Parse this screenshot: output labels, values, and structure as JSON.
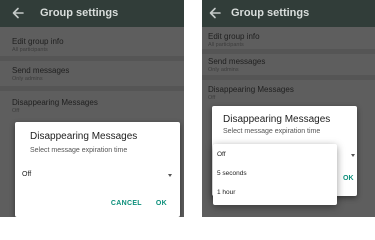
{
  "screens": [
    {
      "appbar": {
        "title": "Group settings",
        "back_icon": "arrow-left-icon"
      },
      "settings": [
        {
          "title": "Edit group info",
          "subtitle": "All participants"
        },
        {
          "title": "Send messages",
          "subtitle": "Only admins"
        },
        {
          "title": "Disappearing Messages",
          "subtitle": "Off"
        }
      ],
      "dialog": {
        "title": "Disappearing Messages",
        "subtitle": "Select message expiration time",
        "selected_value": "Off",
        "cancel_label": "CANCEL",
        "ok_label": "OK"
      }
    },
    {
      "appbar": {
        "title": "Group settings",
        "back_icon": "arrow-left-icon"
      },
      "settings": [
        {
          "title": "Edit group info",
          "subtitle": "All participants"
        },
        {
          "title": "Send messages",
          "subtitle": "Only admins"
        },
        {
          "title": "Disappearing Messages",
          "subtitle": "Off"
        }
      ],
      "dialog": {
        "title": "Disappearing Messages",
        "subtitle": "Select message expiration time",
        "ok_label": "OK"
      },
      "dropdown_options": [
        "Off",
        "5 seconds",
        "1 hour"
      ]
    }
  ],
  "colors": {
    "appbar": "#313d39",
    "dimmed_background": "#5e5e5e",
    "accent": "#0d8f7b",
    "dialog": "#ffffff"
  }
}
